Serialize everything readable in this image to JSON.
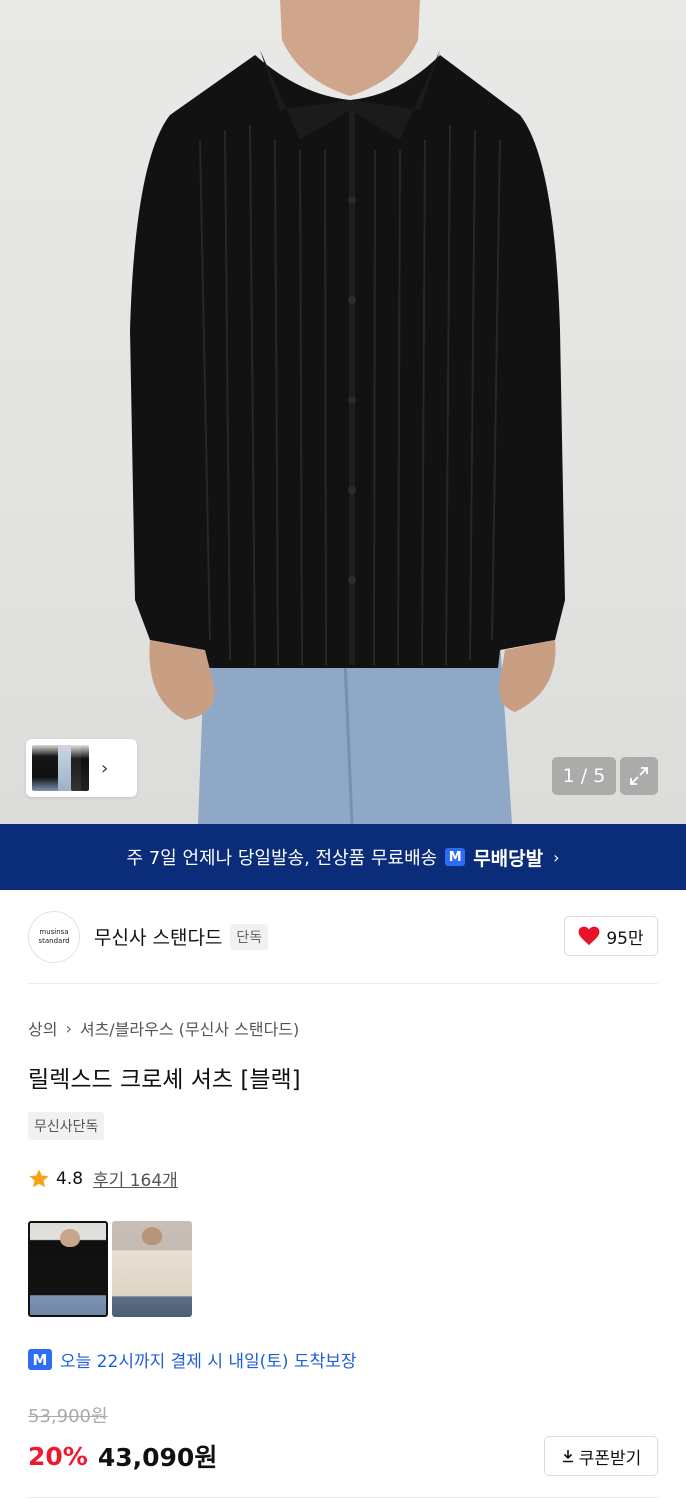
{
  "gallery": {
    "counter": "1 / 5",
    "expand_icon": "expand-icon",
    "strip_icon": "chevron-right-icon"
  },
  "banner": {
    "text": "주 7일 언제나 당일발송, 전상품 무료배송",
    "badge": "M",
    "brand": "무배당발",
    "color": "#0b2c78"
  },
  "brand": {
    "logo_line1": "musinsa",
    "logo_line2": "standard",
    "name": "무신사 스탠다드",
    "tag": "단독",
    "likes": "95만"
  },
  "breadcrumb": {
    "level1": "상의",
    "level2": "셔츠/블라우스 (무신사 스탠다드)"
  },
  "product": {
    "title": "릴렉스드 크로셰 셔츠 [블랙]",
    "exclusive_label": "무신사단독",
    "rating": "4.8",
    "review_label": "후기 164개",
    "colors": [
      "black",
      "beige"
    ],
    "selected_color": "black"
  },
  "delivery": {
    "badge": "M",
    "text": "오늘 22시까지 결제 시 내일(토) 도착보장"
  },
  "price": {
    "original": "53,900원",
    "discount": "20%",
    "final": "43,090원",
    "coupon_label": "쿠폰받기",
    "discount_color": "#f0182c"
  }
}
